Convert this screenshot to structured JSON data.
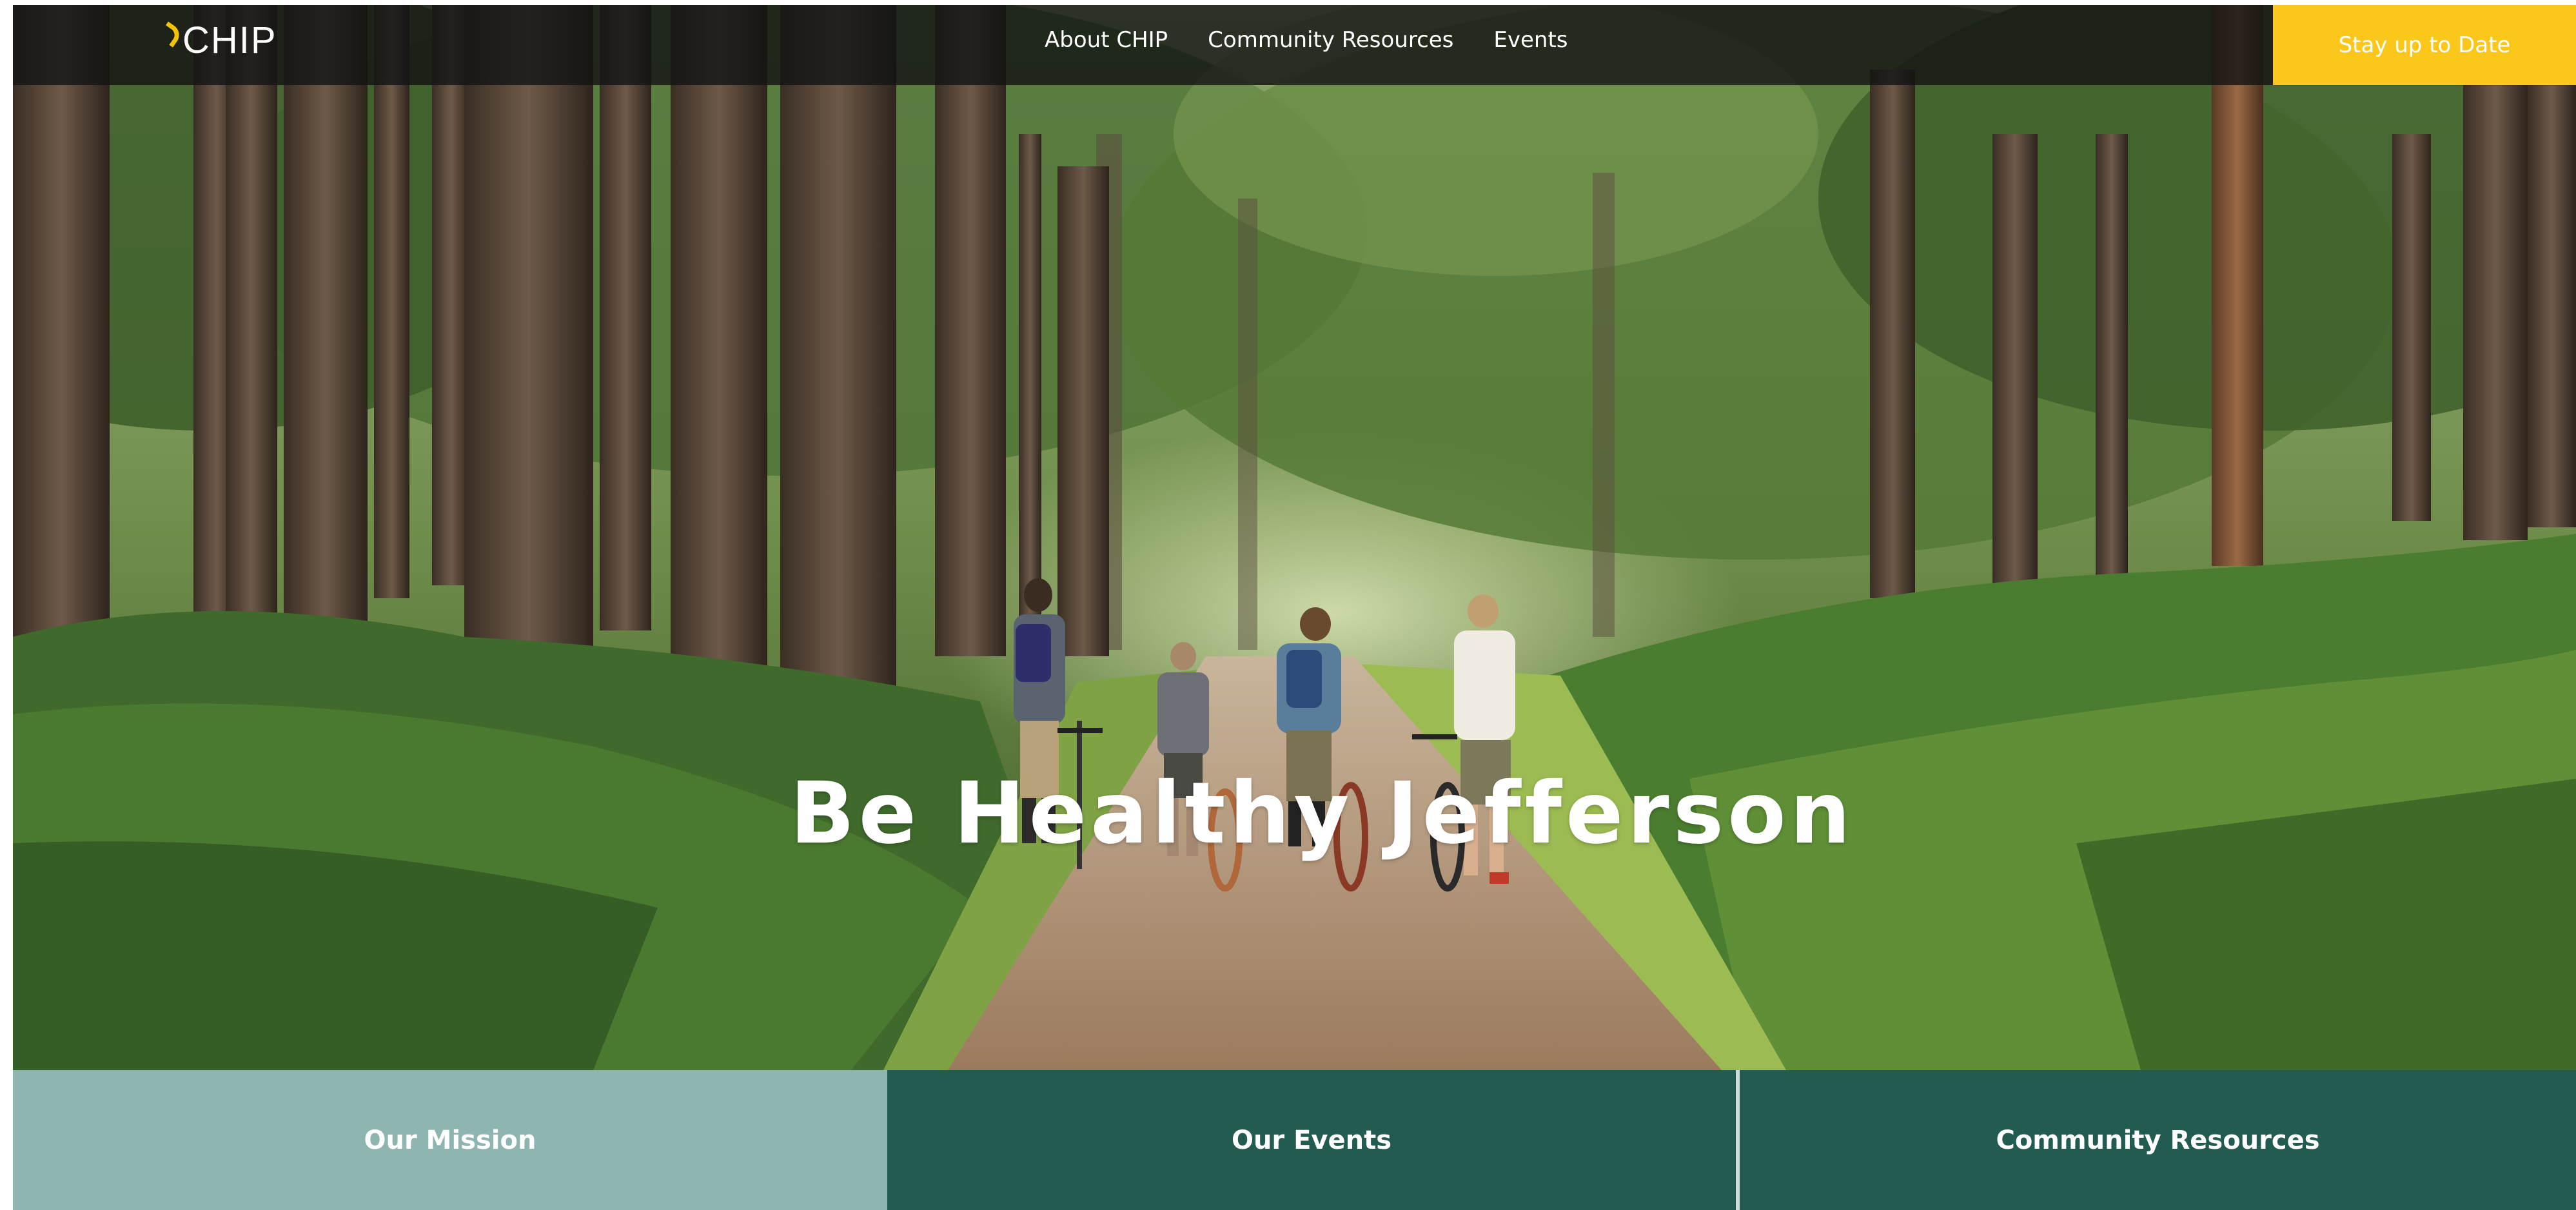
{
  "brand": {
    "logo_text": "CHIP",
    "accent_color": "#fcc71b"
  },
  "nav": {
    "links": [
      {
        "label": "About CHIP"
      },
      {
        "label": "Community Resources"
      },
      {
        "label": "Events"
      }
    ],
    "cta_label": "Stay up to Date"
  },
  "hero": {
    "headline": "Be Healthy Jefferson",
    "image_subject": "family walking bicycles on a forest path"
  },
  "panels": [
    {
      "label": "Our Mission",
      "color": "#8fb5b1"
    },
    {
      "label": "Our Events",
      "color": "#225b4f"
    },
    {
      "label": "Community Resources",
      "color": "#225b4f"
    }
  ]
}
